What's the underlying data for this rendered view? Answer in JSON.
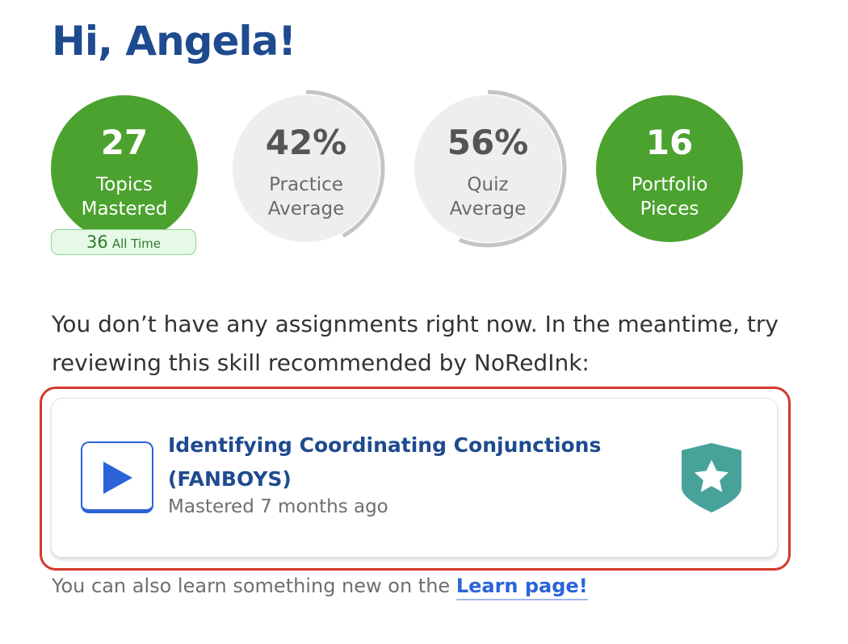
{
  "greeting": "Hi, Angela!",
  "stats": [
    {
      "value": "27",
      "label_line1": "Topics",
      "label_line2": "Mastered"
    },
    {
      "value": "42%",
      "label_line1": "Practice",
      "label_line2": "Average",
      "progress": 0.42
    },
    {
      "value": "56%",
      "label_line1": "Quiz",
      "label_line2": "Average",
      "progress": 0.56
    },
    {
      "value": "16",
      "label_line1": "Portfolio",
      "label_line2": "Pieces"
    }
  ],
  "all_time": {
    "value": "36",
    "label": "All Time"
  },
  "message": "You don’t have any assignments right now. In the meantime, try reviewing this skill recommended by NoRedInk:",
  "recommendation": {
    "title": "Identifying Coordinating Conjunctions (FANBOYS)",
    "status": "Mastered 7 months ago",
    "icon": "play-icon",
    "badge_icon": "star-shield-icon"
  },
  "footer": {
    "text": "You can also learn something new on the ",
    "link_text": "Learn page!"
  },
  "colors": {
    "heading": "#1e4a8f",
    "green": "#4ba22e",
    "gray_circle": "#eeeeee",
    "ring": "#c4c4c4",
    "link": "#2a64d8",
    "highlight_border": "#d23a2a",
    "badge": "#47a39a"
  }
}
